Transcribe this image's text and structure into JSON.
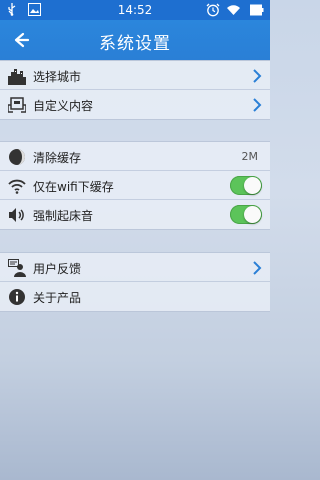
{
  "status_bar": {
    "time": "14:52"
  },
  "header": {
    "title": "系统设置"
  },
  "group1": [
    {
      "label": "选择城市",
      "icon": "city-icon"
    },
    {
      "label": "自定义内容",
      "icon": "custom-content-icon"
    }
  ],
  "group2": [
    {
      "label": "清除缓存",
      "icon": "clear-cache-icon",
      "value": "2M"
    },
    {
      "label": "仅在wifi下缓存",
      "icon": "wifi-icon",
      "toggle_on": true
    },
    {
      "label": "强制起床音",
      "icon": "speaker-icon",
      "toggle_on": true
    }
  ],
  "group3": [
    {
      "label": "用户反馈",
      "icon": "feedback-icon"
    },
    {
      "label": "关于产品",
      "icon": "info-icon"
    }
  ],
  "colors": {
    "accent": "#2a7fd6",
    "toggle_on": "#5cc45a"
  }
}
